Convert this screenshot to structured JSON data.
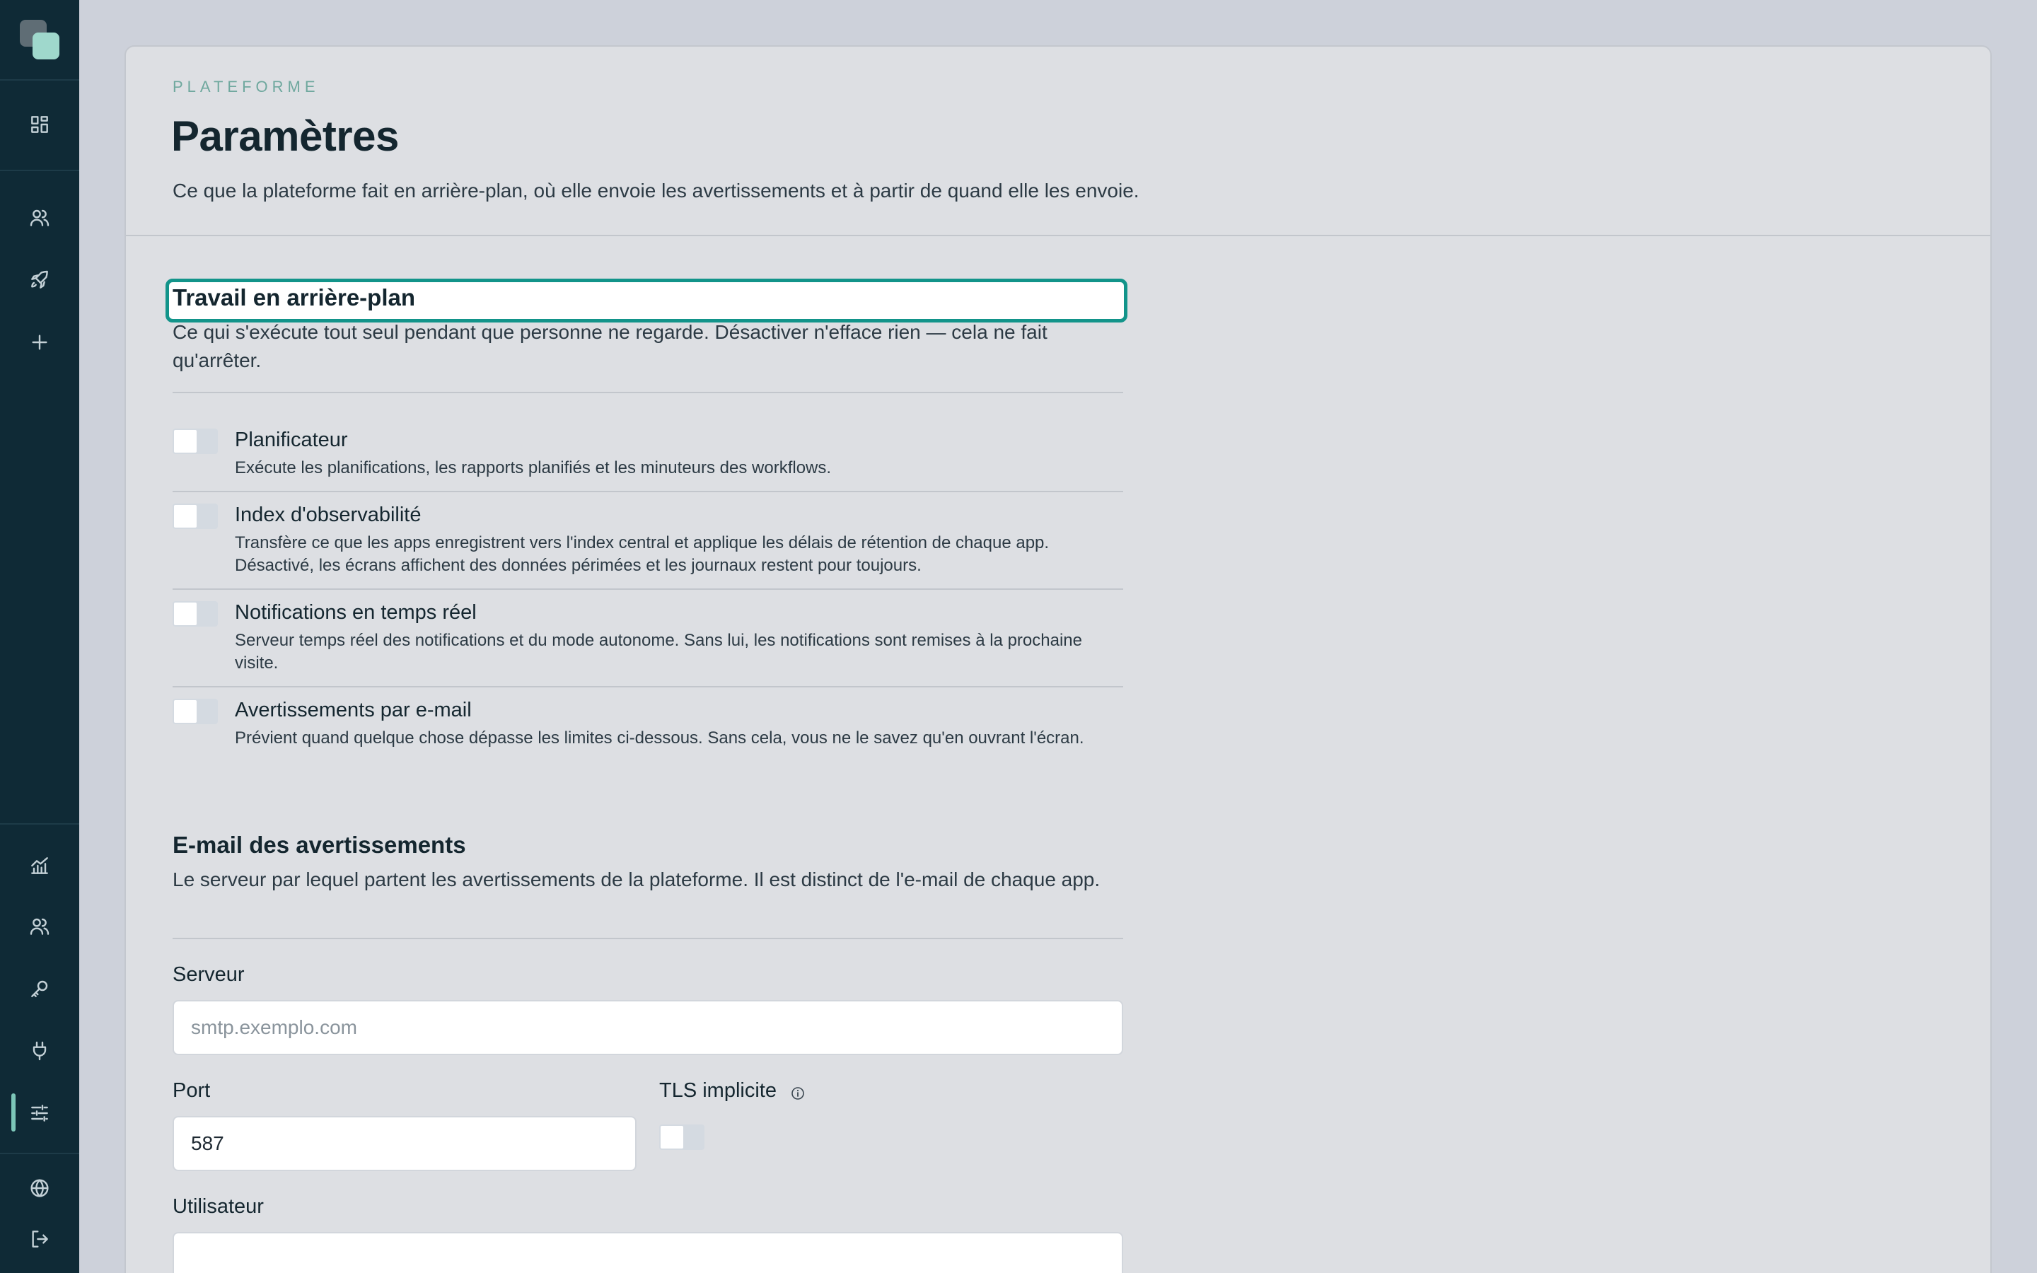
{
  "header": {
    "eyebrow": "PLATEFORME",
    "title": "Paramètres",
    "subtitle": "Ce que la plateforme fait en arrière-plan, où elle envoie les avertissements et à partir de quand elle les envoie."
  },
  "background": {
    "title": "Travail en arrière-plan",
    "description": "Ce qui s'exécute tout seul pendant que personne ne regarde. Désactiver n'efface rien — cela ne fait qu'arrêter.",
    "items": [
      {
        "label": "Planificateur",
        "description": "Exécute les planifications, les rapports planifiés et les minuteurs des workflows.",
        "enabled": false
      },
      {
        "label": "Index d'observabilité",
        "description": "Transfère ce que les apps enregistrent vers l'index central et applique les délais de rétention de chaque app. Désactivé, les écrans affichent des données périmées et les journaux restent pour toujours.",
        "enabled": false
      },
      {
        "label": "Notifications en temps réel",
        "description": "Serveur temps réel des notifications et du mode autonome. Sans lui, les notifications sont remises à la prochaine visite.",
        "enabled": false
      },
      {
        "label": "Avertissements par e-mail",
        "description": "Prévient quand quelque chose dépasse les limites ci-dessous. Sans cela, vous ne le savez qu'en ouvrant l'écran.",
        "enabled": false
      }
    ]
  },
  "email": {
    "title": "E-mail des avertissements",
    "description": "Le serveur par lequel partent les avertissements de la plateforme. Il est distinct de l'e-mail de chaque app.",
    "server_label": "Serveur",
    "server_placeholder": "smtp.exemplo.com",
    "server_value": "",
    "port_label": "Port",
    "port_value": "587",
    "tls_label": "TLS implicite",
    "tls_enabled": false,
    "user_label": "Utilisateur",
    "user_value": ""
  },
  "sidebar": {
    "icons": [
      "dashboard-icon",
      "users-icon",
      "rocket-icon",
      "plus-icon",
      "analytics-icon",
      "team-icon",
      "key-icon",
      "plug-icon",
      "sliders-icon",
      "globe-icon",
      "logout-icon"
    ],
    "active": "sliders-icon"
  },
  "colors": {
    "sidebar": "#0f2a36",
    "accent": "#12948a",
    "eyebrow": "#6fa89e",
    "card": "#dddfe3",
    "page": "#cdd1da"
  }
}
